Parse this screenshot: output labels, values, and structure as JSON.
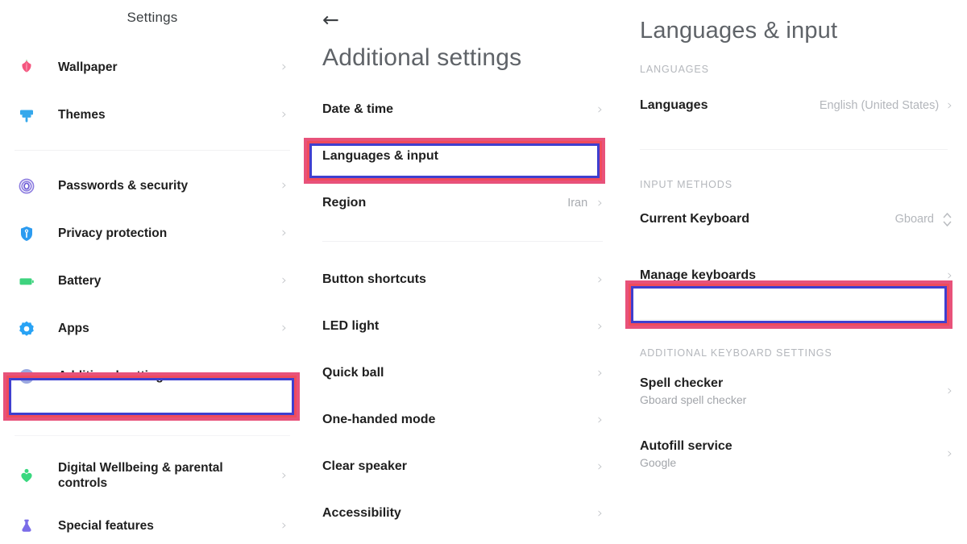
{
  "left_panel": {
    "title": "Settings",
    "items": [
      {
        "label": "Wallpaper",
        "icon": "tulip-flower-icon",
        "color": "#f4557e",
        "chevron": "›"
      },
      {
        "label": "Themes",
        "icon": "paint-brush-icon",
        "color": "#35a8ec",
        "chevron": "›"
      },
      {
        "label": "Passwords & security",
        "icon": "fingerprint-icon",
        "color": "#8c7ce0",
        "chevron": "›"
      },
      {
        "label": "Privacy protection",
        "icon": "shield-key-icon",
        "color": "#2c9bf0",
        "chevron": "›"
      },
      {
        "label": "Battery",
        "icon": "battery-icon",
        "color": "#3ed37e",
        "chevron": "›"
      },
      {
        "label": "Apps",
        "icon": "gear-icon",
        "color": "#29a3f5",
        "chevron": "›"
      },
      {
        "label": "Additional settings",
        "icon": "ellipsis-circle-icon",
        "color": "#9aa7e0",
        "chevron": "›"
      },
      {
        "label": "Digital Wellbeing & parental controls",
        "icon": "heart-person-icon",
        "color": "#3ad87f",
        "chevron": "›"
      },
      {
        "label": "Special features",
        "icon": "flask-icon",
        "color": "#7b6ce8",
        "chevron": "›"
      }
    ]
  },
  "mid_panel": {
    "back_icon": "←",
    "title": "Additional settings",
    "items_top": [
      {
        "label": "Date & time",
        "value": "",
        "chevron": "›"
      },
      {
        "label": "Languages & input",
        "value": "",
        "chevron": "›"
      },
      {
        "label": "Region",
        "value": "Iran",
        "chevron": "›"
      }
    ],
    "items_bottom": [
      {
        "label": "Button shortcuts",
        "value": "",
        "chevron": "›"
      },
      {
        "label": "LED light",
        "value": "",
        "chevron": "›"
      },
      {
        "label": "Quick ball",
        "value": "",
        "chevron": "›"
      },
      {
        "label": "One-handed mode",
        "value": "",
        "chevron": "›"
      },
      {
        "label": "Clear speaker",
        "value": "",
        "chevron": "›"
      },
      {
        "label": "Accessibility",
        "value": "",
        "chevron": "›"
      }
    ]
  },
  "right_panel": {
    "title": "Languages & input",
    "section_languages": "LANGUAGES",
    "languages_row": {
      "label": "Languages",
      "value": "English (United States)",
      "chevron": "›"
    },
    "section_input_methods": "INPUT METHODS",
    "current_keyboard_row": {
      "label": "Current Keyboard",
      "value": "Gboard",
      "icon": "up-down-chevron-icon"
    },
    "manage_keyboards_row": {
      "label": "Manage keyboards",
      "chevron": "›"
    },
    "section_additional": "ADDITIONAL KEYBOARD SETTINGS",
    "spell_checker_row": {
      "label": "Spell checker",
      "sub": "Gboard spell checker",
      "chevron": "›"
    },
    "autofill_row": {
      "label": "Autofill service",
      "sub": "Google",
      "chevron": "›"
    }
  },
  "annotations": {
    "outer_color": "#e8527a",
    "mid_color": "#ef4b5c",
    "inner_color": "#3f3fcf",
    "boxes": [
      {
        "target": "additional-settings-row"
      },
      {
        "target": "languages-and-input-row"
      },
      {
        "target": "manage-keyboards-row"
      }
    ]
  }
}
